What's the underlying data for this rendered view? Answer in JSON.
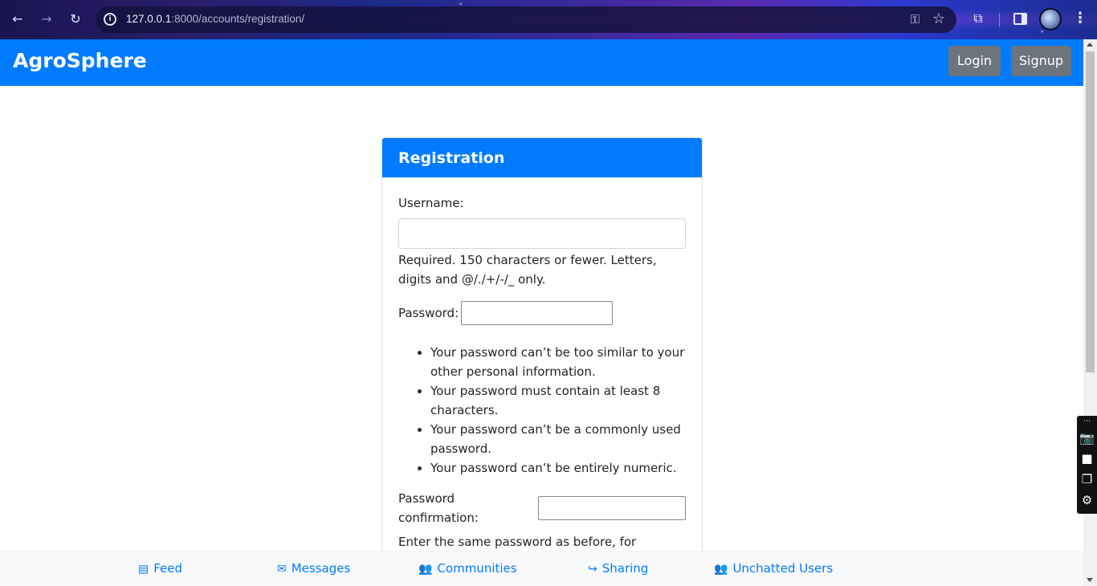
{
  "browser": {
    "url_host": "127.0.0.1",
    "url_rest": ":8000/accounts/registration/"
  },
  "navbar": {
    "brand": "AgroSphere",
    "login_label": "Login",
    "signup_label": "Signup"
  },
  "card": {
    "title": "Registration",
    "username_label": "Username:",
    "username_value": "",
    "username_help": "Required. 150 characters or fewer. Letters, digits and @/./+/-/_ only.",
    "password_label": "Password:",
    "password_value": "",
    "password_rules": [
      "Your password can’t be too similar to your other personal information.",
      "Your password must contain at least 8 characters.",
      "Your password can’t be a commonly used password.",
      "Your password can’t be entirely numeric."
    ],
    "confirm_label": "Password confirmation:",
    "confirm_value": "",
    "confirm_help": "Enter the same password as before, for verification."
  },
  "bottom_nav": {
    "items": [
      {
        "label": "Feed",
        "icon": "newspaper-icon"
      },
      {
        "label": "Messages",
        "icon": "envelope-icon"
      },
      {
        "label": "Communities",
        "icon": "users-icon"
      },
      {
        "label": "Sharing",
        "icon": "share-icon"
      },
      {
        "label": "Unchatted Users",
        "icon": "users-icon"
      }
    ]
  },
  "colors": {
    "primary": "#007bff",
    "secondary_button": "#6c757d"
  }
}
